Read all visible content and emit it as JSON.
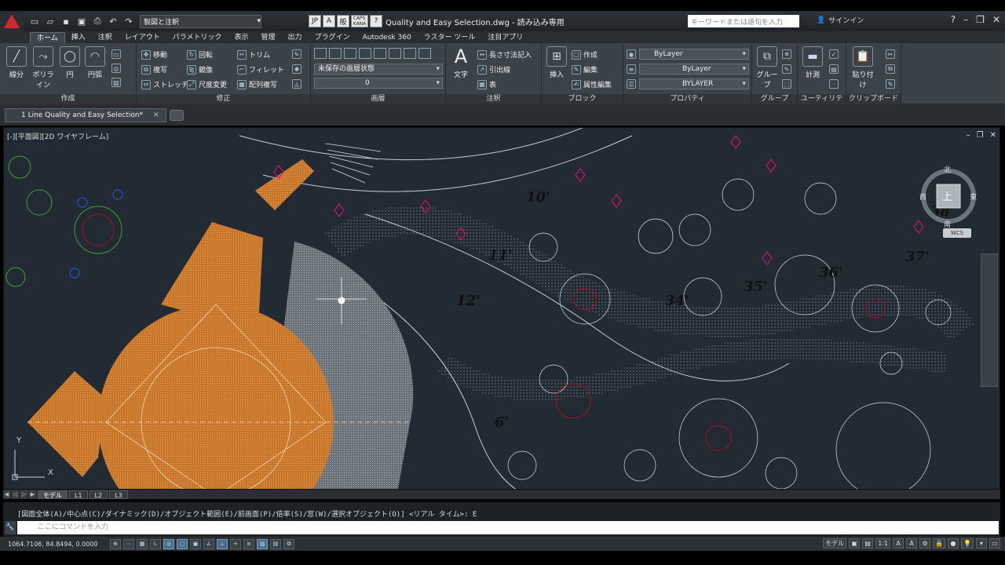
{
  "titlebar": {
    "workspace": "製図と注釈",
    "ime": [
      "JP",
      "A",
      "般",
      "CAPS KANA",
      "?"
    ],
    "doc_title": "Quality and Easy Selection.dwg - 読み込み専用",
    "search_placeholder": "キーワードまたは語句を入力",
    "signin": "サインイン"
  },
  "tabs": [
    "ホーム",
    "挿入",
    "注釈",
    "レイアウト",
    "パラメトリック",
    "表示",
    "管理",
    "出力",
    "プラグイン",
    "Autodesk 360",
    "ラスター ツール",
    "注目アプリ"
  ],
  "ribbon": {
    "draw": {
      "title": "作成",
      "line": "線分",
      "polyline": "ポリライン",
      "circle": "円",
      "arc": "円弧"
    },
    "modify": {
      "title": "修正",
      "move": "移動",
      "rotate": "回転",
      "trim": "トリム",
      "copy": "複写",
      "mirror": "鏡像",
      "fillet": "フィレット",
      "stretch": "ストレッチ",
      "scale": "尺度変更",
      "array": "配列複写"
    },
    "layers": {
      "title": "画層",
      "state": "未保存の画層状態",
      "current": "0"
    },
    "annotation": {
      "title": "注釈",
      "text": "文字",
      "dimension": "長さ寸法記入",
      "leader": "引出線",
      "table": "表"
    },
    "block": {
      "title": "ブロック",
      "insert": "挿入",
      "create": "作成",
      "edit": "編集",
      "attr": "属性編集"
    },
    "properties": {
      "title": "プロパティ",
      "color": "ByLayer",
      "linetype": "ByLayer",
      "lineweight": "BYLAYER"
    },
    "groups": {
      "title": "グループ",
      "group": "グループ"
    },
    "utilities": {
      "title": "ユーティリティ",
      "measure": "計測"
    },
    "clipboard": {
      "title": "クリップボード",
      "paste": "貼り付け"
    }
  },
  "doc_tab": "1 Line Quality and Easy Selection*",
  "viewport": {
    "label": "[-][平面図][2D ワイヤフレーム]",
    "navcube": {
      "top": "上",
      "north": "北",
      "south": "南",
      "east": "東",
      "west": "西"
    },
    "wcs": "WCS",
    "annotations": [
      "10'",
      "11'",
      "12'",
      "6'",
      "34'",
      "35'",
      "36'",
      "37'",
      "38'"
    ]
  },
  "layout_tabs": [
    "モデル",
    "L1",
    "L2",
    "L3"
  ],
  "command": {
    "history": "[図面全体(A)/中心点(C)/ダイナミック(D)/オブジェクト範囲(E)/前画面(P)/倍率(S)/窓(W)/選択オブジェクト(O)] <リアル タイム>: E",
    "placeholder": "ここにコマンドを入力"
  },
  "status": {
    "coords": "1064.7106, 84.8494, 0.0000",
    "model": "モデル",
    "scale": "1:1"
  }
}
